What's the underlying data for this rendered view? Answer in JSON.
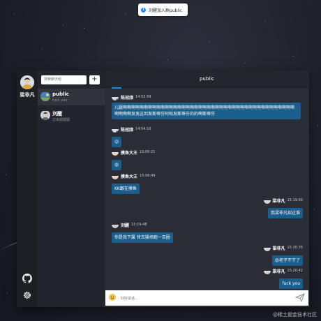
{
  "toast": {
    "text": "刘醒加入群public",
    "icon": "info-icon"
  },
  "current_user": {
    "name": "梁非凡"
  },
  "sidebar": {
    "search_placeholder": "搜索聊天组",
    "add_label": "+",
    "conversations": [
      {
        "name": "public",
        "preview": "fuck you",
        "active": true
      },
      {
        "name": "刘醒",
        "preview": "过来腿腿腿"
      }
    ]
  },
  "chat": {
    "title": "public",
    "messages": [
      {
        "sender": "陈冠颀",
        "time": "14:53:59",
        "text": "儿腿啊啊啊啊啊啊啊啊啊啊啊啊啊啊啊啊啊啊啊啊啊啊啊啊啊啊啊啊啊啊啊啊啊啊啊啊啊啊啊啊啊啊啊啊啊发发这到发斯蒂芬阿帕发斯蒂芬的的啊斯蒂芬",
        "side": "left"
      },
      {
        "sender": "陈冠颀",
        "time": "14:54:10",
        "text": "😉",
        "side": "left"
      },
      {
        "sender": "摸鱼大王",
        "time": "15:06:21",
        "text": "😡",
        "side": "left"
      },
      {
        "sender": "摸鱼大王",
        "time": "15:06:49",
        "text": "KK跟在摸鱼",
        "side": "left"
      },
      {
        "sender": "梁非凡",
        "time": "15:19:00",
        "text": "我梁非凡招过谁",
        "side": "right"
      },
      {
        "sender": "刘醒",
        "time": "15:19:48",
        "text": "你是我下属 快去操场跑一百圈",
        "side": "left"
      },
      {
        "sender": "梁非凡",
        "time": "15:20:35",
        "text": "😡老子不干了",
        "side": "right"
      },
      {
        "sender": "梁非凡",
        "time": "15:20:42",
        "text": "fuck you",
        "side": "right"
      }
    ],
    "input_placeholder": "好好说话..."
  },
  "watermark": "@稀土掘金技术社区",
  "colors": {
    "bubble": "#1b5d8b",
    "accent": "#1a8ce0"
  }
}
